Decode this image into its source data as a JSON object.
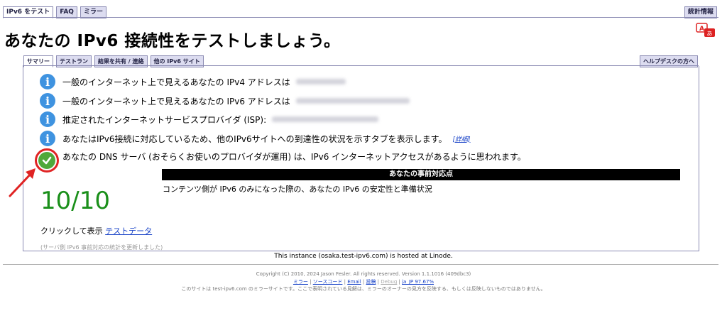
{
  "top_tabs": [
    "IPv6 をテスト",
    "FAQ",
    "ミラー"
  ],
  "stats_tab": "統計情報",
  "page_title": "あなたの IPv6 接続性をテストしましょう。",
  "sub_tabs": [
    "サマリー",
    "テストラン",
    "結果を共有 / 連絡",
    "他の IPv6 サイト"
  ],
  "help_tab": "ヘルプデスクの方へ",
  "results": [
    {
      "text": "一般のインターネット上で見えるあなたの IPv4 アドレスは",
      "icon": "info-icon"
    },
    {
      "text": "一般のインターネット上で見えるあなたの IPv6 アドレスは",
      "icon": "info-icon"
    },
    {
      "text": "推定されたインターネットサービスプロバイダ (ISP):",
      "icon": "info-icon"
    },
    {
      "text": "あなたはIPv6接続に対応しているため、他のIPv6サイトへの到達性の状況を示すタブを表示します。",
      "icon": "info-icon",
      "detail": "[詳細]"
    },
    {
      "text": "あなたの DNS サーバ (おそらくお使いのプロバイダが運用) は、IPv6 インターネットアクセスがあるように思われます。",
      "icon": "check-icon"
    }
  ],
  "readiness": {
    "header": "あなたの事前対応点",
    "score": "10/10",
    "description": "コンテンツ側が IPv6 のみになった際の、あなたの IPv6 の安定性と準備状況"
  },
  "click_show": {
    "prefix": "クリックして表示",
    "link": "テストデータ"
  },
  "updated_note": "(サーバ側 IPv6 事前対応の統計を更新しました)",
  "hosted": "This instance (osaka.test-ipv6.com) is hosted at Linode.",
  "footer": {
    "copyright": "Copyright (C) 2010, 2024 Jason Fesler. All rights reserved. Version 1.1.1016 (409dbc3)",
    "links": [
      "ミラー",
      "ソースコード",
      "Email",
      "投稿",
      "Debug",
      "ja_JP 97.67%"
    ],
    "mirror_note": "このサイトは test-ipv6.com のミラーサイトです。ここで表明されている見解は、ミラーのオーナーの見方を反映する、もしくは反映しないものではありません。"
  },
  "colors": {
    "info": "#3f93e0",
    "ok": "#4fa83a",
    "score": "#1a8f1a",
    "arrow": "#e02323"
  }
}
